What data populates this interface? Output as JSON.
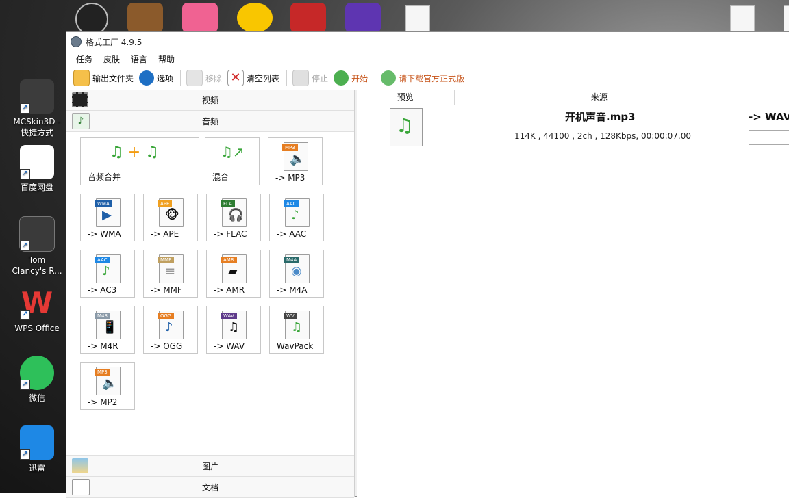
{
  "desktop": {
    "icons": [
      {
        "label": "MCSkin3D -\n快捷方式",
        "color": "#3c3c3c"
      },
      {
        "label": "百度网盘",
        "color": "#ffffff"
      },
      {
        "label": "Tom\nClancy's R...",
        "color": "#3a3a3a"
      },
      {
        "label": "WPS Office",
        "color": "#d32f2f"
      },
      {
        "label": "微信",
        "color": "#2ec05a"
      },
      {
        "label": "迅雷",
        "color": "#1e88e5"
      }
    ]
  },
  "window": {
    "title": "格式工厂 4.9.5",
    "menu": [
      "任务",
      "皮肤",
      "语言",
      "帮助"
    ],
    "toolbar": {
      "output_folder": "输出文件夹",
      "options": "选项",
      "remove": "移除",
      "clear_list": "清空列表",
      "stop": "停止",
      "start": "开始",
      "download_official": "请下载官方正式版"
    },
    "categories": {
      "video": "视频",
      "audio": "音频",
      "image": "图片",
      "document": "文档"
    },
    "audio_tiles": [
      {
        "label": "音频合并",
        "badge": ""
      },
      {
        "label": "混合",
        "badge": ""
      },
      {
        "label": "-> MP3",
        "badge": "MP3"
      },
      {
        "label": "-> WMA",
        "badge": "WMA"
      },
      {
        "label": "-> APE",
        "badge": "APE"
      },
      {
        "label": "-> FLAC",
        "badge": "FLA"
      },
      {
        "label": "-> AAC",
        "badge": "AAC"
      },
      {
        "label": "-> AC3",
        "badge": "AAC"
      },
      {
        "label": "-> MMF",
        "badge": "MMF"
      },
      {
        "label": "-> AMR",
        "badge": "AMR"
      },
      {
        "label": "-> M4A",
        "badge": "M4A"
      },
      {
        "label": "-> M4R",
        "badge": "M4R"
      },
      {
        "label": "-> OGG",
        "badge": "OGG"
      },
      {
        "label": "-> WAV",
        "badge": "WAV"
      },
      {
        "label": "WavPack",
        "badge": "WV"
      },
      {
        "label": "-> MP2",
        "badge": "MP3"
      }
    ],
    "list": {
      "columns": [
        "预览",
        "来源"
      ],
      "file": {
        "name": "开机声音.mp3",
        "info": "114K , 44100 , 2ch , 128Kbps, 00:00:07.00",
        "output": "-> WAV"
      }
    }
  }
}
